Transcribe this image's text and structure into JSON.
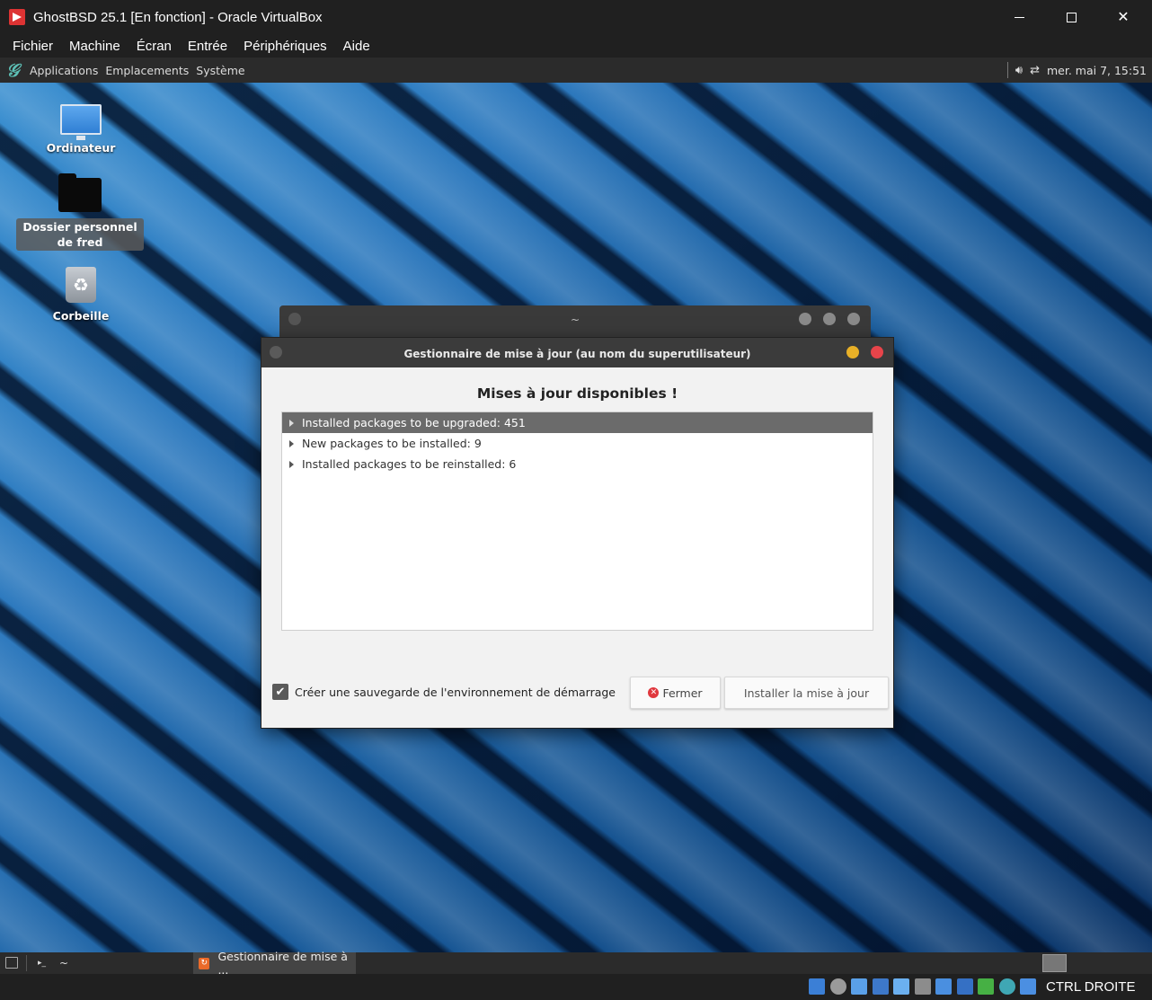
{
  "vbox": {
    "title": "GhostBSD 25.1 [En fonction] - Oracle VirtualBox",
    "menu": [
      "Fichier",
      "Machine",
      "Écran",
      "Entrée",
      "Périphériques",
      "Aide"
    ],
    "host_key": "CTRL DROITE",
    "status_icons": [
      "hard-disk-icon",
      "optical-drive-icon",
      "audio-icon",
      "network-icon",
      "usb-icon",
      "shared-folders-icon",
      "display-icon",
      "recording-icon",
      "cpu-icon",
      "guest-additions-icon",
      "mouse-integration-icon",
      "keyboard-icon"
    ]
  },
  "top_panel": {
    "menus": [
      "Applications",
      "Emplacements",
      "Système"
    ],
    "clock": "mer. mai 7, 15:51"
  },
  "desktop": {
    "icons": [
      "Ordinateur",
      "Dossier personnel de fred",
      "Corbeille"
    ]
  },
  "term_window": {
    "title": "~"
  },
  "dialog": {
    "title": "Gestionnaire de mise à jour (au nom du superutilisateur)",
    "heading": "Mises à jour disponibles !",
    "tree": [
      "Installed packages to be upgraded: 451",
      "New packages to be installed: 9",
      "Installed packages to be reinstalled: 6"
    ],
    "backup_label": "Créer une sauvegarde de l'environnement de démarrage",
    "backup_checked": true,
    "close_label": "Fermer",
    "install_label": "Installer la mise à jour"
  },
  "bottom_panel": {
    "tasks": [
      "~",
      "Gestionnaire de mise à ..."
    ]
  },
  "colors": {
    "accent_close": "#e7444a",
    "accent_min": "#e8b027",
    "selection": "#6b6b6b"
  }
}
